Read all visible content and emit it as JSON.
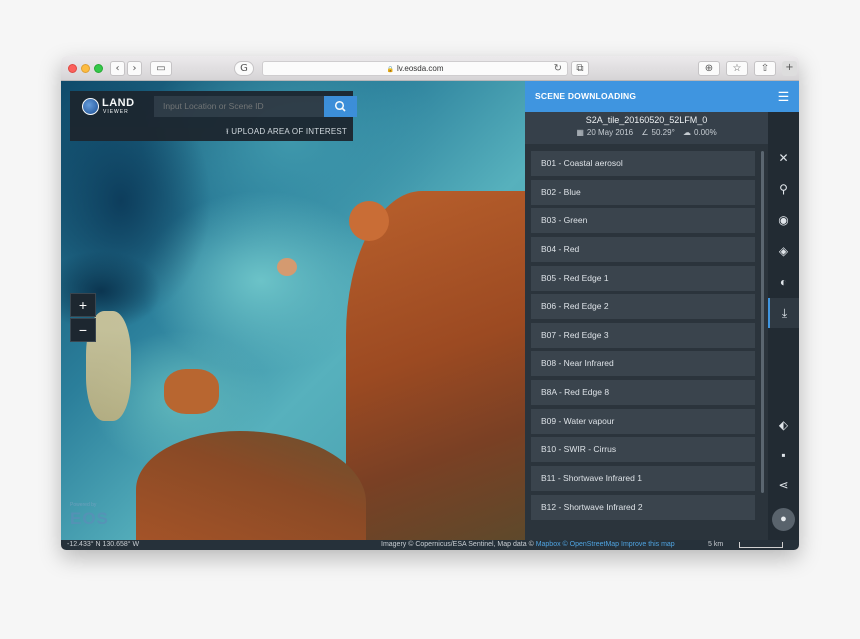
{
  "browser": {
    "url": "lv.eosda.com",
    "back_icon": "chevron-left-icon",
    "forward_icon": "chevron-right-icon"
  },
  "search": {
    "placeholder": "Input Location or Scene ID"
  },
  "logo": {
    "line1": "LAND",
    "line2": "VIEWER"
  },
  "upload_label": "UPLOAD AREA OF INTEREST",
  "zoom": {
    "in": "+",
    "out": "−"
  },
  "watermark": {
    "small": "Powered by",
    "big": "EOS"
  },
  "panel": {
    "title": "SCENE DOWNLOADING",
    "scene_name": "S2A_tile_20160520_52LFM_0",
    "date": "20 May 2016",
    "sun_angle": "50.29°",
    "cloud": "0.00%",
    "bands": [
      "B01 - Coastal aerosol",
      "B02 - Blue",
      "B03 - Green",
      "B04 - Red",
      "B05 - Red Edge 1",
      "B06 - Red Edge 2",
      "B07 - Red Edge 3",
      "B08 - Near Infrared",
      "B8A - Red Edge 8",
      "B09 - Water vapour",
      "B10 - SWIR - Cirrus",
      "B11 - Shortwave Infrared 1",
      "B12 - Shortwave Infrared 2"
    ]
  },
  "footer": {
    "coords": "-12.433° N 130.658° W",
    "credit_prefix": "Imagery © Copernicus/ESA Sentinel, Map data ©",
    "credit_links": "Mapbox © OpenStreetMap Improve this map",
    "scale": "5 km"
  },
  "colors": {
    "accent": "#3f95e0",
    "panel_bg": "#2b343c",
    "band_bg": "#3a444d"
  }
}
